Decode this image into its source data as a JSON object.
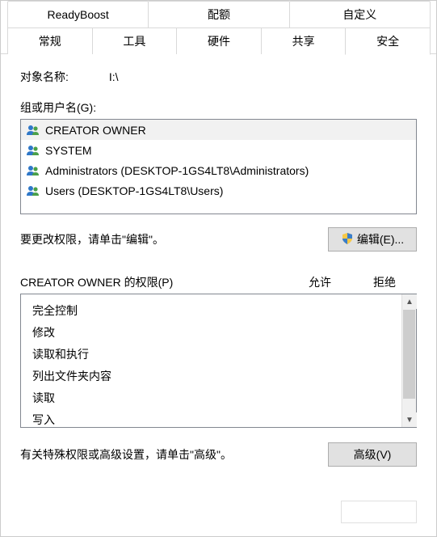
{
  "tabs": {
    "top": [
      {
        "label": "ReadyBoost"
      },
      {
        "label": "配额"
      },
      {
        "label": "自定义"
      }
    ],
    "bottom": [
      {
        "label": "常规"
      },
      {
        "label": "工具"
      },
      {
        "label": "硬件"
      },
      {
        "label": "共享"
      },
      {
        "label": "安全",
        "active": true
      }
    ]
  },
  "object_name_label": "对象名称:",
  "object_name_value": "I:\\",
  "groups_label": "组或用户名(G):",
  "groups": [
    {
      "name": "CREATOR OWNER",
      "selected": true
    },
    {
      "name": "SYSTEM"
    },
    {
      "name": "Administrators (DESKTOP-1GS4LT8\\Administrators)"
    },
    {
      "name": "Users (DESKTOP-1GS4LT8\\Users)"
    }
  ],
  "edit_hint": "要更改权限，请单击\"编辑\"。",
  "edit_button": "编辑(E)...",
  "perm_title": "CREATOR OWNER 的权限(P)",
  "perm_allow": "允许",
  "perm_deny": "拒绝",
  "permissions": [
    {
      "name": "完全控制"
    },
    {
      "name": "修改"
    },
    {
      "name": "读取和执行"
    },
    {
      "name": "列出文件夹内容"
    },
    {
      "name": "读取"
    },
    {
      "name": "写入"
    }
  ],
  "advanced_hint": "有关特殊权限或高级设置，请单击\"高级\"。",
  "advanced_button": "高级(V)"
}
